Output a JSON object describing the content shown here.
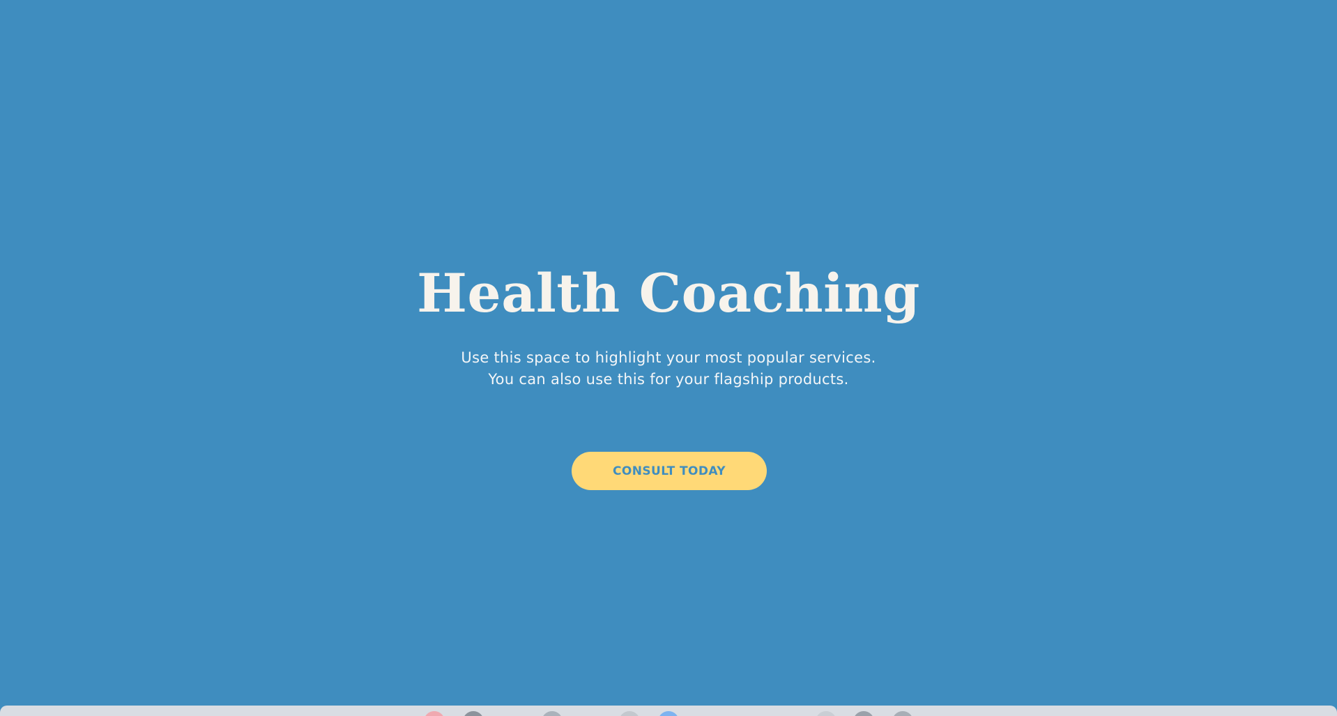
{
  "hero": {
    "title": "Health Coaching",
    "subtitle_line1": "Use this space to highlight your most popular services.",
    "subtitle_line2": "You can also use this for your flagship products.",
    "cta_label": "CONSULT TODAY"
  },
  "colors": {
    "background": "#3f8dbf",
    "button": "#ffd977",
    "button_text": "#3f8dbf",
    "title_text": "#f7f3ec"
  },
  "dock": {
    "icons": [
      "app-icon",
      "app-icon",
      "app-icon",
      "app-icon",
      "app-icon",
      "app-icon",
      "app-icon",
      "app-icon"
    ]
  }
}
